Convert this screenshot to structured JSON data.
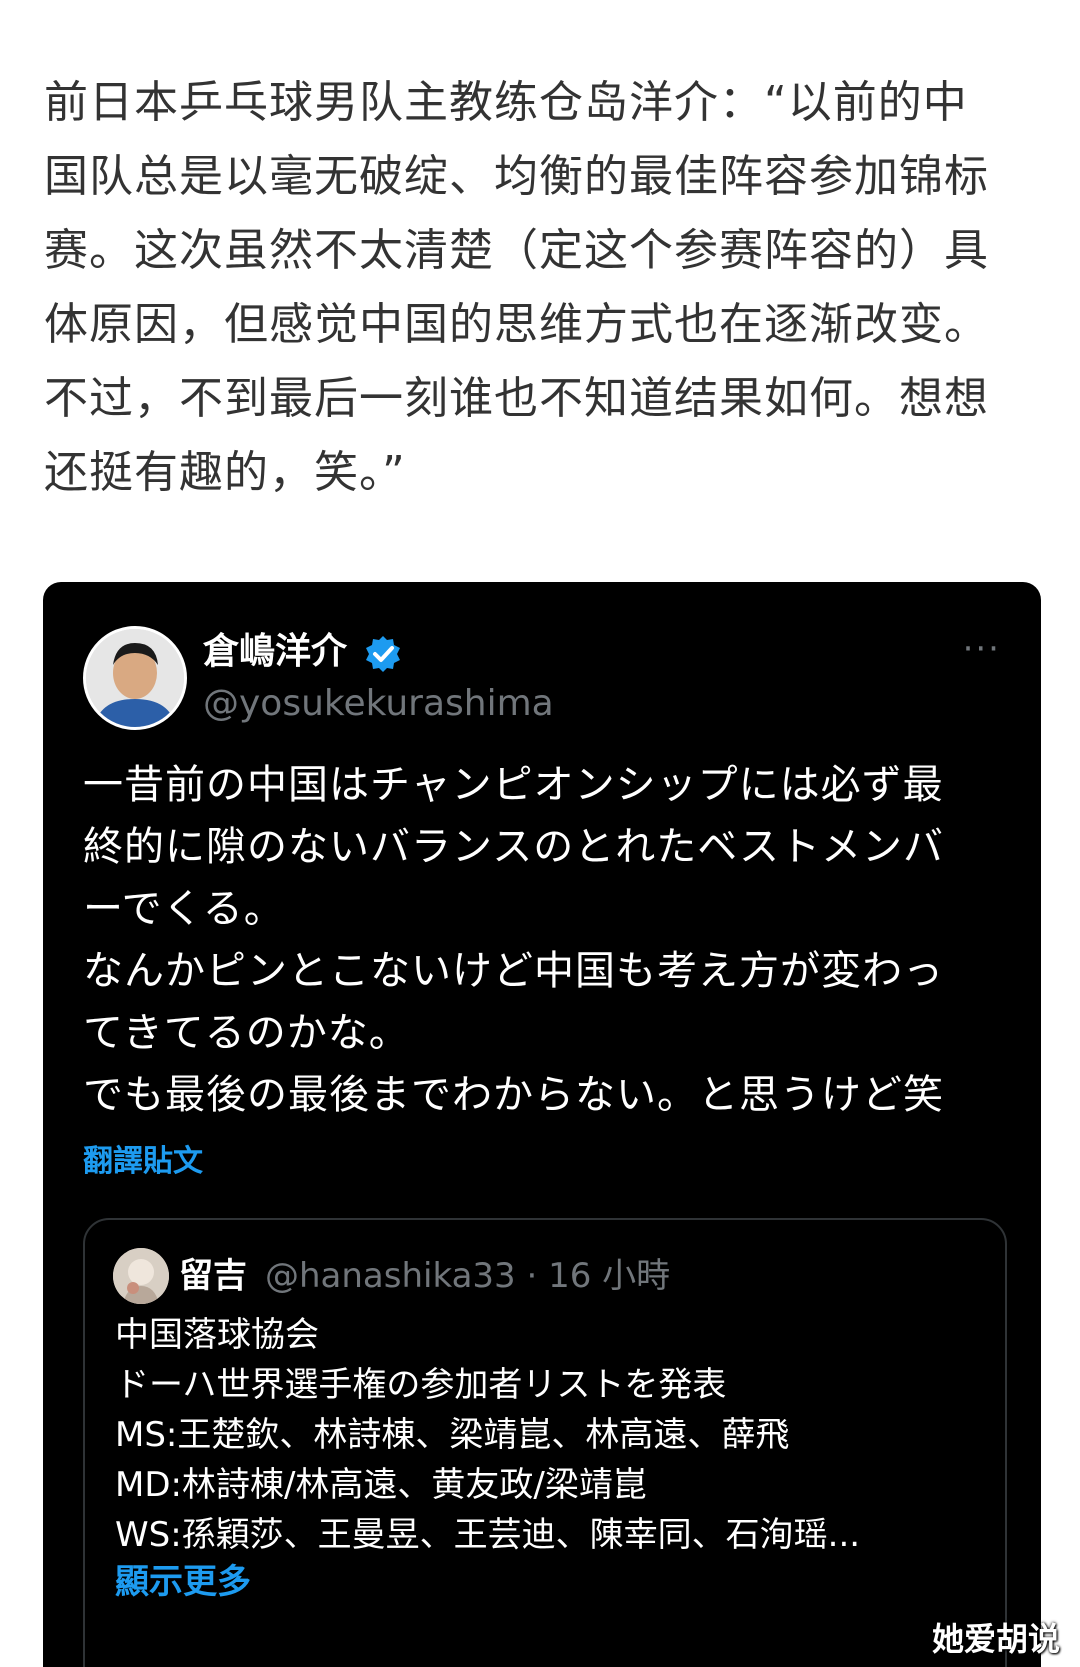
{
  "article": {
    "lines": [
      "前日本乒乓球男队主教练仓岛洋介：“以前的中",
      "国队总是以毫无破绽、均衡的最佳阵容参加锦标",
      "赛。这次虽然不太清楚（定这个参赛阵容的）具",
      "体原因，但感觉中国的思维方式也在逐渐改变。",
      "不过，不到最后一刻谁也不知道结果如何。想想",
      "还挺有趣的，笑。”"
    ]
  },
  "tweet": {
    "display_name": "倉嶋洋介",
    "handle": "@yosukekurashima",
    "verified_icon": "verified-badge-icon",
    "verified_color": "#1d9bf0",
    "more_label": "···",
    "body_lines": [
      "一昔前の中国はチャンピオンシップには必ず最",
      "終的に隙のないバランスのとれたベストメンバ",
      "ーでくる。",
      "なんかピンとこないけど中国も考え方が変わっ",
      "てきてるのかな。",
      "でも最後の最後までわからない。と思うけど笑"
    ],
    "translate_label": "翻譯貼文"
  },
  "quote": {
    "display_name": "留吉",
    "meta": "@hanashika33 · 16 小時",
    "body_lines": [
      "中国落球協会",
      "ドーハ世界選手権の参加者リストを発表",
      "MS:王楚欽、林詩棟、梁靖崑、林高遠、薛飛",
      "MD:林詩棟/林高遠、黄友政/梁靖崑",
      "WS:孫穎莎、王曼昱、王芸迪、陳幸同、石洵瑶..."
    ],
    "show_more_label": "顯示更多"
  },
  "watermark": "她爱胡说",
  "colors": {
    "card_bg": "#000000",
    "link": "#1d9bf0",
    "muted": "#71767b",
    "article_text": "#333333"
  }
}
